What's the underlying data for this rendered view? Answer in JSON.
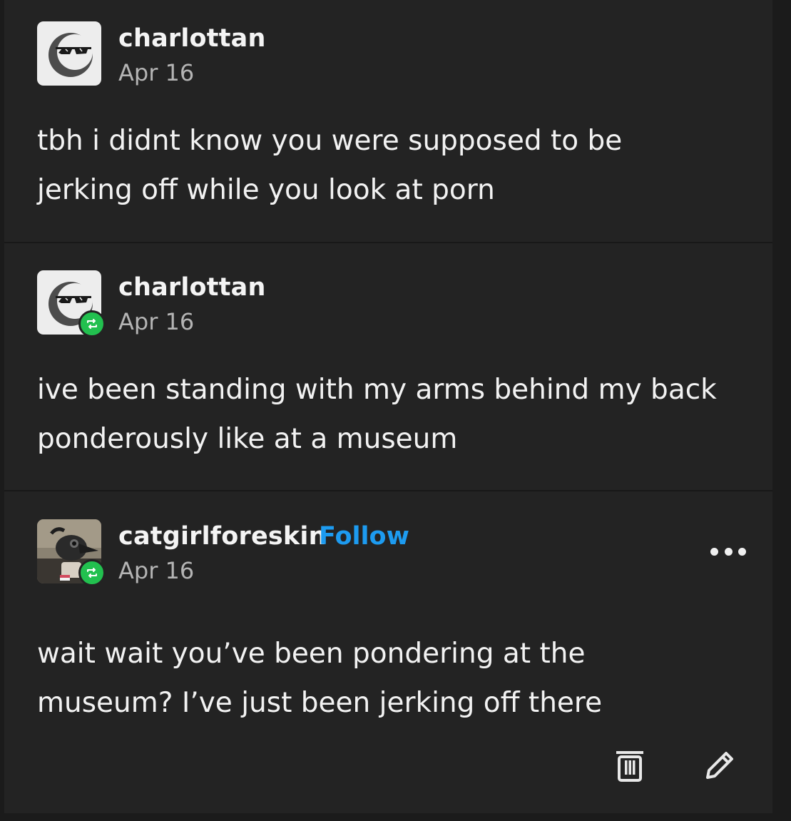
{
  "posts": [
    {
      "username": "charlottan",
      "date": "Apr 16",
      "avatar": "sunglasses-moon-avatar",
      "reblogged": false,
      "body_lines": [
        "tbh i didnt know you were supposed to be",
        "jerking off while you look at porn"
      ]
    },
    {
      "username": "charlottan",
      "date": "Apr 16",
      "avatar": "sunglasses-moon-avatar",
      "reblogged": true,
      "body_lines": [
        "ive been standing with my arms behind my back",
        "ponderously like at a museum"
      ]
    },
    {
      "username": "catgirlforeskin",
      "follow_label": "Follow",
      "date": "Apr 16",
      "avatar": "plague-mask-photo-avatar",
      "reblogged": true,
      "body_lines": [
        "wait wait you’ve been pondering at the",
        "museum? I’ve just been jerking off there"
      ]
    }
  ],
  "icons": {
    "reblog": "reblog-icon",
    "more": "more-options-icon",
    "delete": "trash-icon",
    "edit": "pencil-icon"
  },
  "colors": {
    "background": "#232323",
    "text": "#f2f2f2",
    "meta": "#b4b4b4",
    "follow": "#1d9bf0",
    "reblog_badge": "#22c04f"
  }
}
